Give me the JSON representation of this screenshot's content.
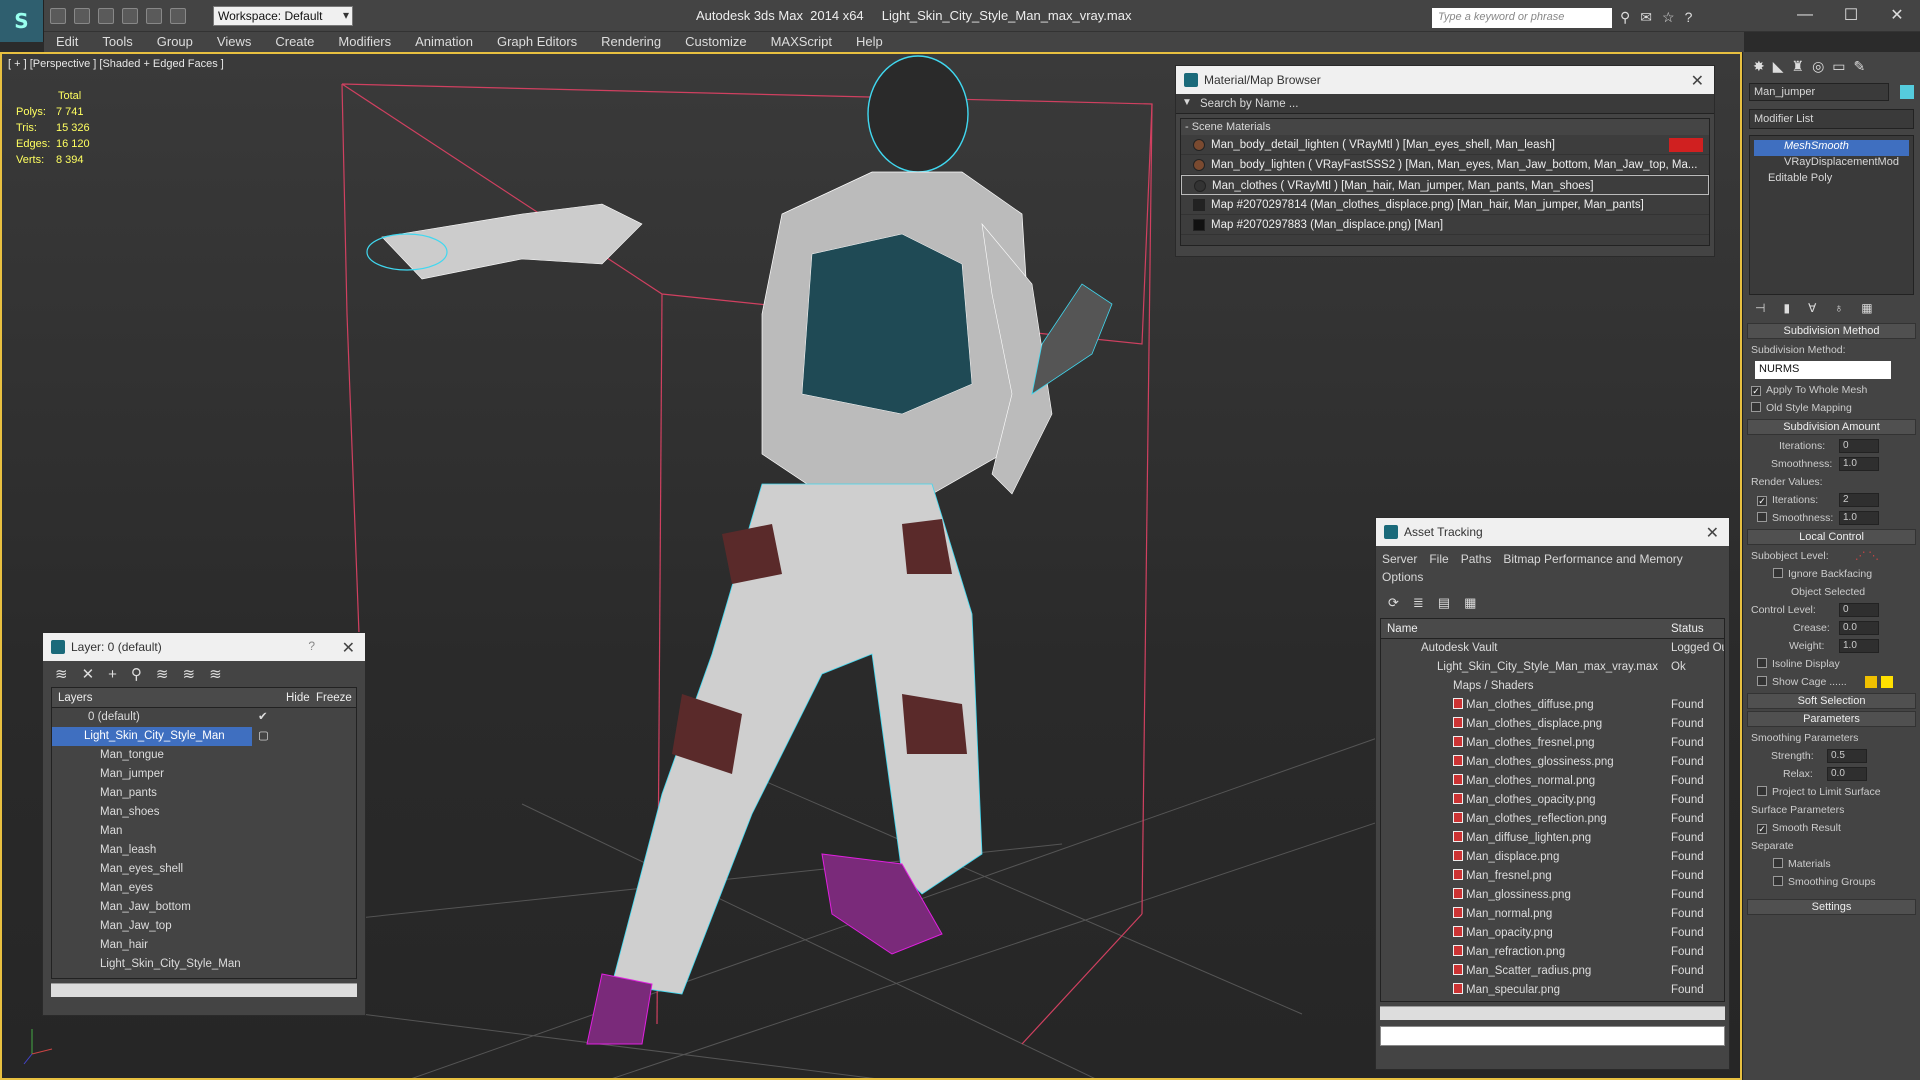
{
  "app": {
    "title": "Autodesk 3ds Max  2014 x64     Light_Skin_City_Style_Man_max_vray.max",
    "workspace": "Workspace: Default",
    "search_placeholder": "Type a keyword or phrase"
  },
  "menu": [
    "Edit",
    "Tools",
    "Group",
    "Views",
    "Create",
    "Modifiers",
    "Animation",
    "Graph Editors",
    "Rendering",
    "Customize",
    "MAXScript",
    "Help"
  ],
  "viewport": {
    "label": "[ + ] [Perspective ] [Shaded + Edged Faces ]",
    "stats_header": "Total",
    "stats": [
      {
        "label": "Polys:",
        "value": "7 741"
      },
      {
        "label": "Tris:",
        "value": "15 326"
      },
      {
        "label": "Edges:",
        "value": "16 120"
      },
      {
        "label": "Verts:",
        "value": "8 394"
      }
    ]
  },
  "layer_panel": {
    "title": "Layer: 0 (default)",
    "help": "?",
    "cols": {
      "layers": "Layers",
      "hide": "Hide",
      "freeze": "Freeze"
    },
    "rows": [
      {
        "name": "0 (default)",
        "level": 1
      },
      {
        "name": "Light_Skin_City_Style_Man",
        "level": 1,
        "selected": true
      },
      {
        "name": "Man_tongue",
        "level": 2
      },
      {
        "name": "Man_jumper",
        "level": 2
      },
      {
        "name": "Man_pants",
        "level": 2
      },
      {
        "name": "Man_shoes",
        "level": 2
      },
      {
        "name": "Man",
        "level": 2
      },
      {
        "name": "Man_leash",
        "level": 2
      },
      {
        "name": "Man_eyes_shell",
        "level": 2
      },
      {
        "name": "Man_eyes",
        "level": 2
      },
      {
        "name": "Man_Jaw_bottom",
        "level": 2
      },
      {
        "name": "Man_Jaw_top",
        "level": 2
      },
      {
        "name": "Man_hair",
        "level": 2
      },
      {
        "name": "Light_Skin_City_Style_Man",
        "level": 2
      }
    ]
  },
  "material_browser": {
    "title": "Material/Map Browser",
    "search": "Search by Name ...",
    "section": "- Scene Materials",
    "items": [
      "Man_body_detail_lighten  ( VRayMtl ) [Man_eyes_shell, Man_leash]",
      "Man_body_lighten  ( VRayFastSSS2 ) [Man, Man_eyes, Man_Jaw_bottom, Man_Jaw_top, Ma...",
      "Man_clothes  ( VRayMtl ) [Man_hair, Man_jumper, Man_pants, Man_shoes]",
      "Map #2070297814 (Man_clothes_displace.png) [Man_hair, Man_jumper, Man_pants]",
      "Map #2070297883 (Man_displace.png) [Man]"
    ]
  },
  "asset_tracking": {
    "title": "Asset Tracking",
    "menu": [
      "Server",
      "File",
      "Paths",
      "Bitmap Performance and Memory",
      "Options"
    ],
    "cols": {
      "name": "Name",
      "status": "Status"
    },
    "rows": [
      {
        "name": "Autodesk Vault",
        "status": "Logged Ou",
        "level": 1
      },
      {
        "name": "Light_Skin_City_Style_Man_max_vray.max",
        "status": "Ok",
        "level": 2
      },
      {
        "name": "Maps / Shaders",
        "status": "",
        "level": 3
      },
      {
        "name": "Man_clothes_diffuse.png",
        "status": "Found",
        "level": 4
      },
      {
        "name": "Man_clothes_displace.png",
        "status": "Found",
        "level": 4
      },
      {
        "name": "Man_clothes_fresnel.png",
        "status": "Found",
        "level": 4
      },
      {
        "name": "Man_clothes_glossiness.png",
        "status": "Found",
        "level": 4
      },
      {
        "name": "Man_clothes_normal.png",
        "status": "Found",
        "level": 4
      },
      {
        "name": "Man_clothes_opacity.png",
        "status": "Found",
        "level": 4
      },
      {
        "name": "Man_clothes_reflection.png",
        "status": "Found",
        "level": 4
      },
      {
        "name": "Man_diffuse_lighten.png",
        "status": "Found",
        "level": 4
      },
      {
        "name": "Man_displace.png",
        "status": "Found",
        "level": 4
      },
      {
        "name": "Man_fresnel.png",
        "status": "Found",
        "level": 4
      },
      {
        "name": "Man_glossiness.png",
        "status": "Found",
        "level": 4
      },
      {
        "name": "Man_normal.png",
        "status": "Found",
        "level": 4
      },
      {
        "name": "Man_opacity.png",
        "status": "Found",
        "level": 4
      },
      {
        "name": "Man_refraction.png",
        "status": "Found",
        "level": 4
      },
      {
        "name": "Man_Scatter_radius.png",
        "status": "Found",
        "level": 4
      },
      {
        "name": "Man_specular.png",
        "status": "Found",
        "level": 4
      }
    ]
  },
  "command_panel": {
    "object_name": "Man_jumper",
    "modifier_list": "Modifier List",
    "stack": [
      "MeshSmooth",
      "VRayDisplacementMod",
      "Editable Poly"
    ],
    "subdiv_method_title": "Subdivision Method",
    "subdiv_method_label": "Subdivision Method:",
    "subdiv_method_value": "NURMS",
    "apply_whole": "Apply To Whole Mesh",
    "old_style": "Old Style Mapping",
    "subdiv_amount_title": "Subdivision Amount",
    "iterations_label": "Iterations:",
    "iterations": "0",
    "smoothness_label": "Smoothness:",
    "smoothness": "1.0",
    "render_values": "Render Values:",
    "render_iterations": "2",
    "render_smoothness": "1.0",
    "local_control_title": "Local Control",
    "subobject_level": "Subobject Level:",
    "ignore_backfacing": "Ignore Backfacing",
    "object_selected": "Object Selected",
    "control_level_label": "Control Level:",
    "control_level": "0",
    "crease_label": "Crease:",
    "crease": "0.0",
    "weight_label": "Weight:",
    "weight": "1.0",
    "isoline": "Isoline Display",
    "show_cage": "Show Cage ......",
    "soft_selection_title": "Soft Selection",
    "parameters_title": "Parameters",
    "smoothing_params": "Smoothing Parameters",
    "strength_label": "Strength:",
    "strength": "0.5",
    "relax_label": "Relax:",
    "relax": "0.0",
    "project_limit": "Project to Limit Surface",
    "surface_params": "Surface Parameters",
    "smooth_result": "Smooth Result",
    "separate": "Separate",
    "materials": "Materials",
    "smoothing_groups": "Smoothing Groups",
    "settings_title": "Settings"
  },
  "colors": {
    "accent": "#e8c040",
    "selection": "#3f6fc0",
    "wire": "#40d8f0",
    "shoes": "#e020e0"
  }
}
